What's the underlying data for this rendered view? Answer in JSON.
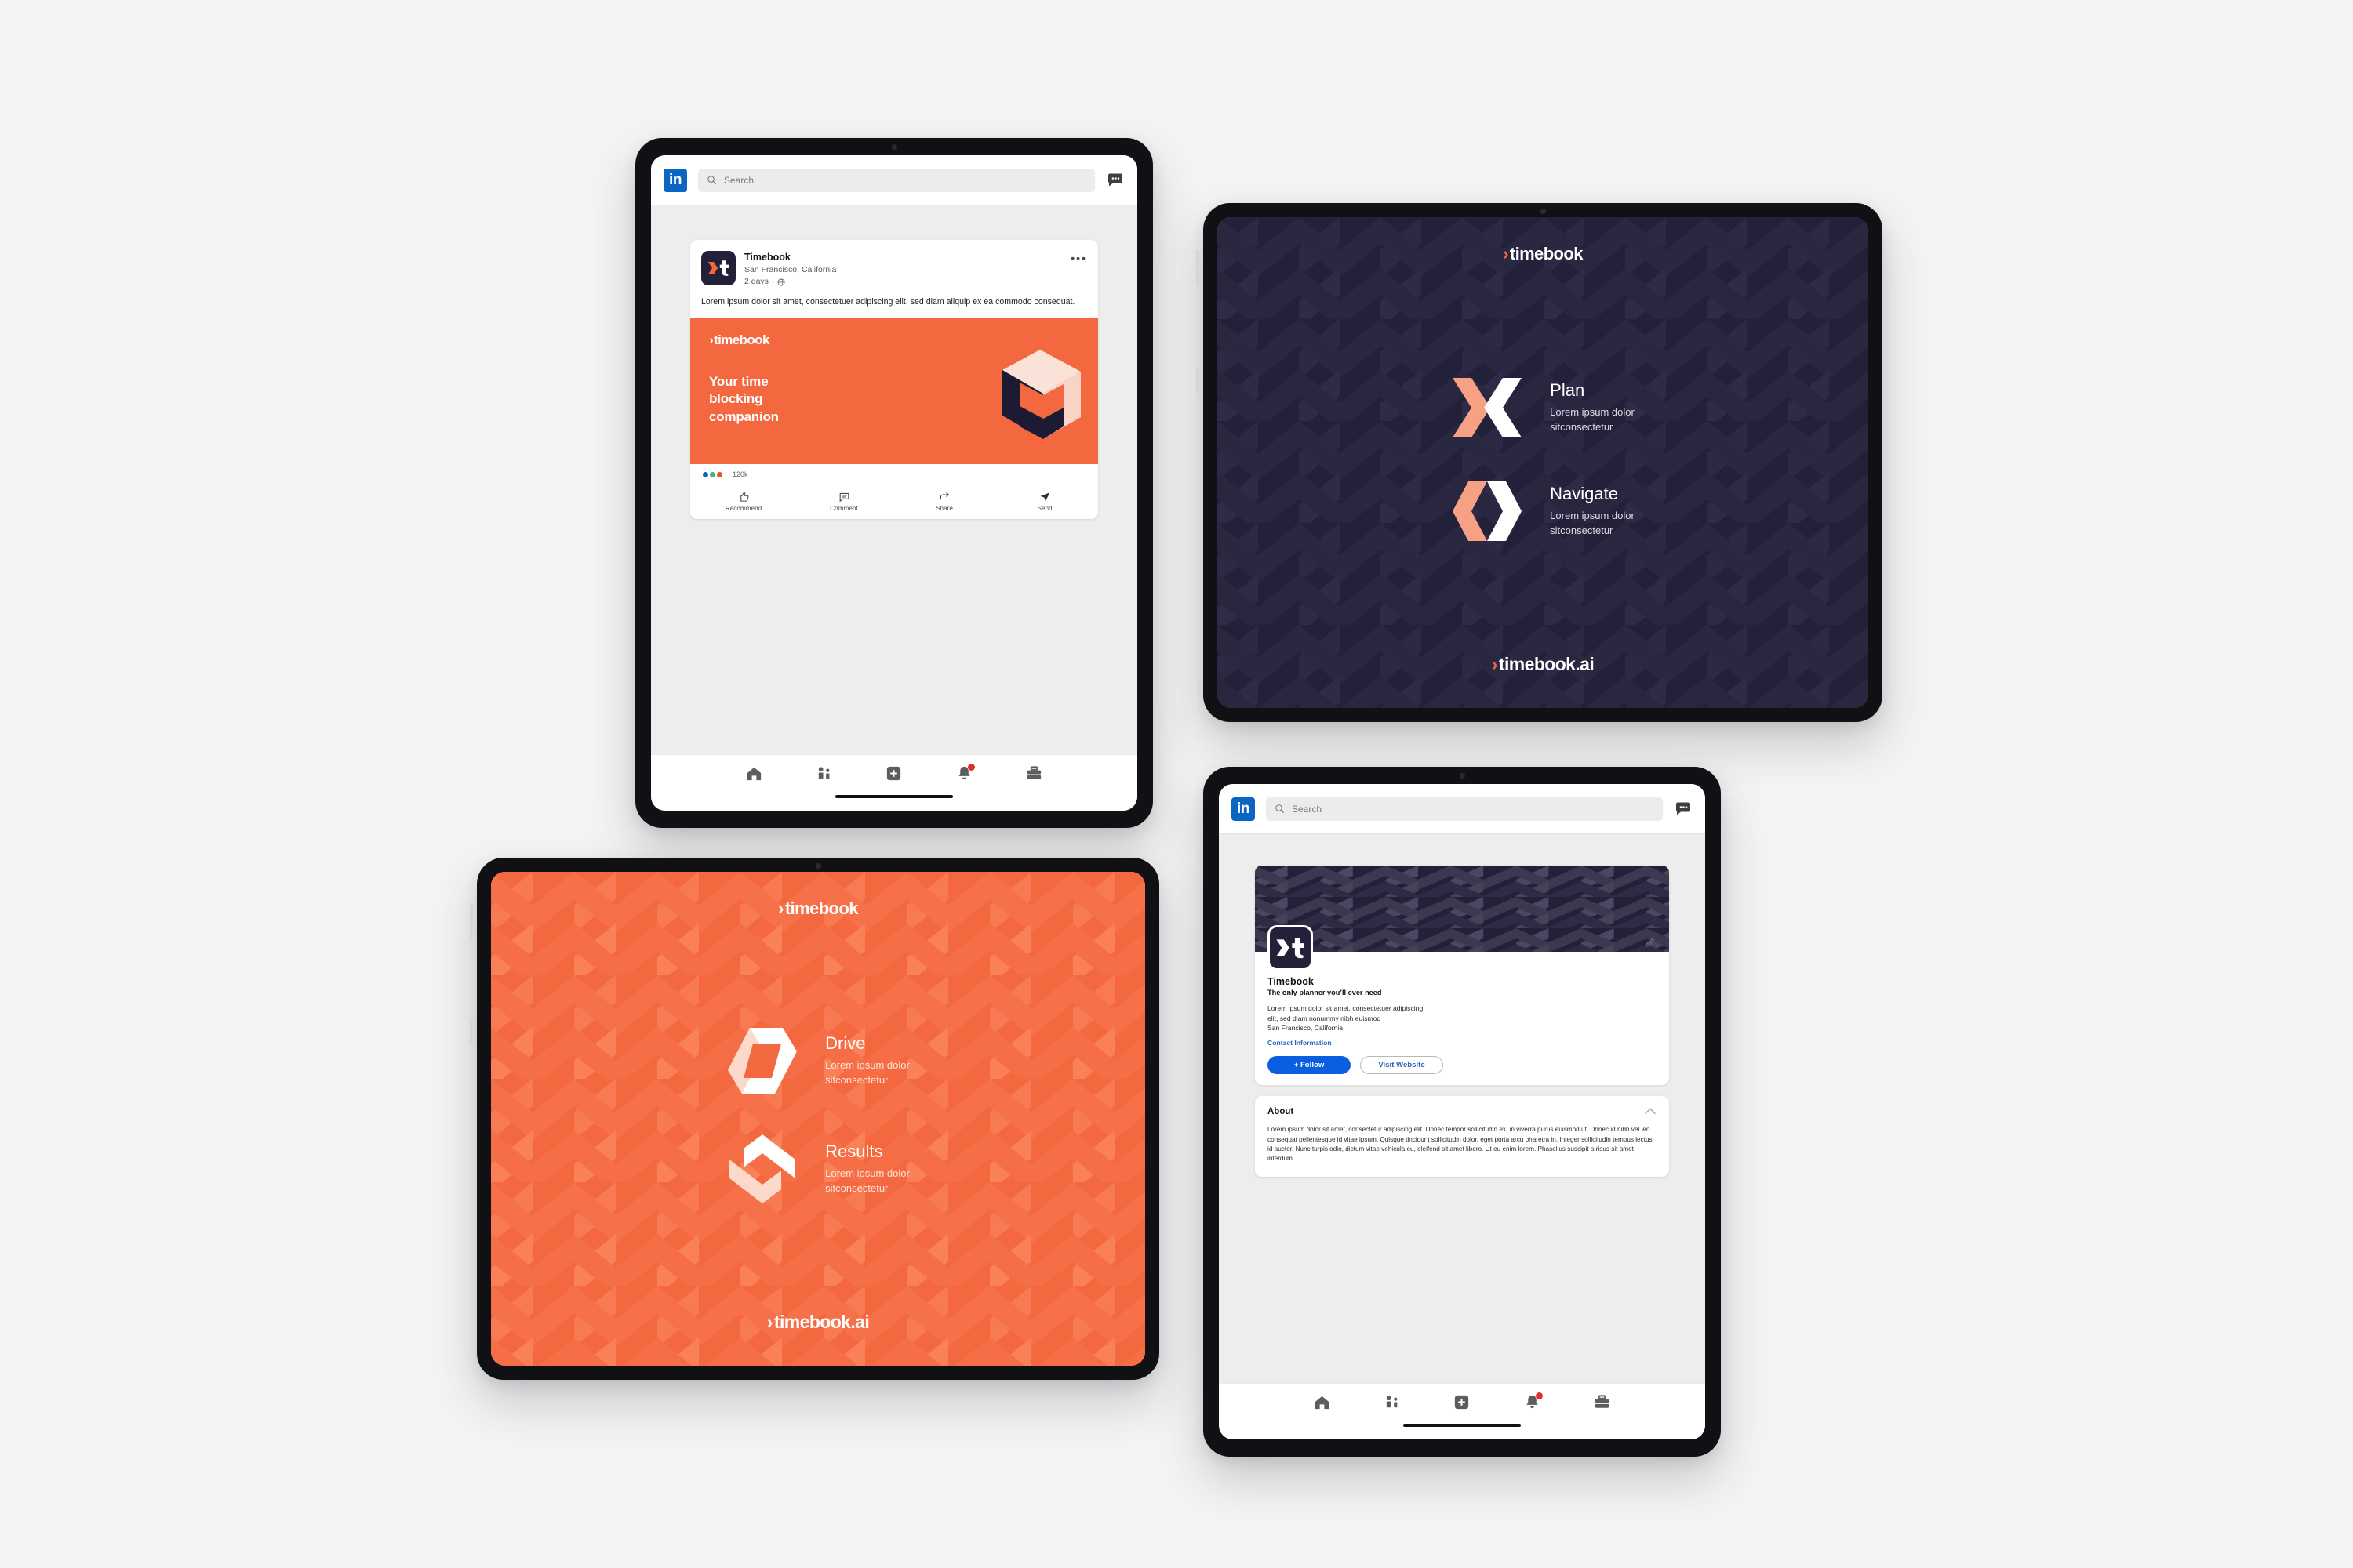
{
  "brand": {
    "name": "timebook",
    "wordmark": "timebook",
    "wordmark_domain": "timebook.ai",
    "chevron_glyph": "›",
    "logo_letter": "t",
    "colors": {
      "orange": "#f4683f",
      "navy": "#232039",
      "salmon": "#f6a183",
      "cream": "#fbe2d8",
      "linkedin_blue": "#0a66c2",
      "follow_blue": "#0a5fe0",
      "canvas": "#f4f4f4"
    }
  },
  "linkedin": {
    "logo_text": "in",
    "search_placeholder": "Search",
    "search_value": "",
    "messaging_icon": "messages-icon",
    "nav": [
      {
        "name": "home",
        "icon": "home-icon",
        "badge": ""
      },
      {
        "name": "network",
        "icon": "my-network-icon",
        "badge": ""
      },
      {
        "name": "post",
        "icon": "add-post-icon",
        "badge": ""
      },
      {
        "name": "notifications",
        "icon": "bell-icon",
        "badge": "●"
      },
      {
        "name": "jobs",
        "icon": "briefcase-icon",
        "badge": ""
      }
    ]
  },
  "feed_post": {
    "author": "Timebook",
    "location": "San Francisco, California",
    "time": "2 days",
    "visibility_icon": "globe-icon",
    "more_icon": "•••",
    "body": "Lorem ipsum dolor sit amet, consectetuer adipiscing elit, sed diam aliquip ex ea commodo consequat.",
    "image": {
      "wordmark": "timebook",
      "headline": "Your time blocking companion",
      "illustration": "isometric-cube-icon"
    },
    "reaction_colors": [
      "#0a66c2",
      "#38b87c",
      "#e8512a"
    ],
    "reaction_count": "120k",
    "actions": [
      {
        "label": "Recommend",
        "icon": "thumbs-up-icon"
      },
      {
        "label": "Comment",
        "icon": "comment-bubble-icon"
      },
      {
        "label": "Share",
        "icon": "share-arrow-icon"
      },
      {
        "label": "Send",
        "icon": "send-paperplane-icon"
      }
    ]
  },
  "dark_slide": {
    "wordmark": "timebook",
    "footer_wordmark": "timebook.ai",
    "features": [
      {
        "title": "Plan",
        "desc_line1": "Lorem ipsum dolor",
        "desc_line2": "sitconsectetur",
        "icon": "plan-x-icon"
      },
      {
        "title": "Navigate",
        "desc_line1": "Lorem ipsum dolor",
        "desc_line2": "sitconsectetur",
        "icon": "navigate-diamond-icon"
      }
    ]
  },
  "orange_slide": {
    "wordmark": "timebook",
    "footer_wordmark": "timebook.ai",
    "features": [
      {
        "title": "Drive",
        "desc_line1": "Lorem ipsum dolor",
        "desc_line2": "sitconsectetur",
        "icon": "drive-hexagon-icon"
      },
      {
        "title": "Results",
        "desc_line1": "Lorem ipsum dolor",
        "desc_line2": "sitconsectetur",
        "icon": "results-chevrons-icon"
      }
    ]
  },
  "company_profile": {
    "cover_pattern": "chevron-pattern",
    "logo_letter": "t",
    "edit_icon": "pencil-icon",
    "name": "Timebook",
    "tagline": "The only planner you’ll ever need",
    "desc_line1": "Lorem ipsum dolor sit amet, consectetuer adipiscing",
    "desc_line2": "elit, sed diam nonummy nibh euismod",
    "location": "San Francisco, California",
    "contact_link": "Contact Information",
    "follow_button": "+ Follow",
    "website_button": "Visit Website",
    "about_title": "About",
    "about_collapse_icon": "chevron-up-icon",
    "about_body": "Lorem ipsum dolor sit amet, consectetur adipiscing elit. Donec tempor sollicitudin ex, in viverra purus euismod ut. Donec id nibh vel leo consequat pellentesque id vitae ipsum. Quisque tincidunt sollicitudin dolor, eget porta arcu pharetra in. Integer sollicitudin tempus lectus id auctor. Nunc turpis odio, dictum vitae vehicula eu, eleifend sit amet libero. Ut eu enim lorem. Phasellus suscipit a risus sit amet interdum."
  }
}
